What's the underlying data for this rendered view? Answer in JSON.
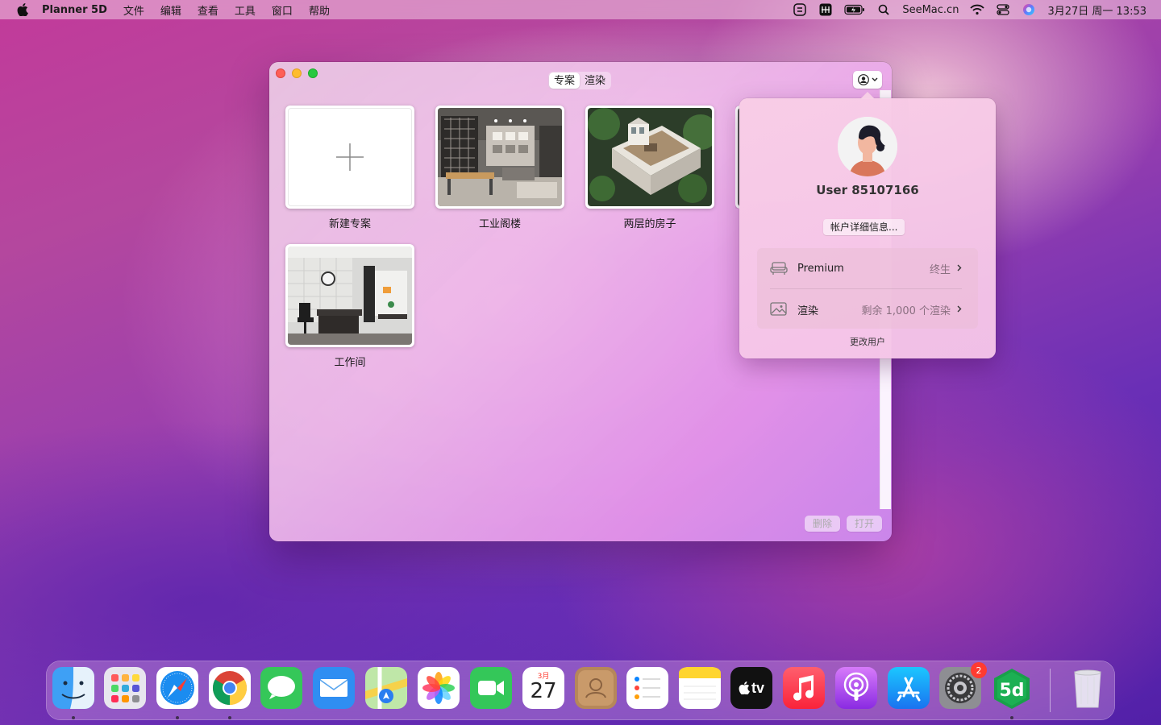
{
  "menubar": {
    "app_name": "Planner 5D",
    "menus": [
      "文件",
      "编辑",
      "查看",
      "工具",
      "窗口",
      "帮助"
    ],
    "site": "SeeMac.cn",
    "datetime": "3月27日 周一  13:53"
  },
  "window": {
    "tabs": [
      "专案",
      "渲染"
    ],
    "active_tab": "专案",
    "projects": [
      {
        "label": "新建专案"
      },
      {
        "label": "工业阁楼"
      },
      {
        "label": "两层的房子"
      },
      {
        "label": "工作间"
      }
    ],
    "buttons": {
      "delete": "删除",
      "open": "打开"
    }
  },
  "popover": {
    "username": "User 85107166",
    "account_details": "帐户详细信息...",
    "rows": [
      {
        "label": "Premium",
        "value": "终生",
        "icon": "sofa-icon"
      },
      {
        "label": "渲染",
        "value": "剩余 1,000 个渲染",
        "icon": "image-icon"
      }
    ],
    "change_user": "更改用户"
  },
  "dock": {
    "apps": [
      "Finder",
      "Launchpad",
      "Safari",
      "Chrome",
      "Messages",
      "Mail",
      "Maps",
      "Photos",
      "FaceTime",
      "Calendar",
      "Contacts",
      "Reminders",
      "Notes",
      "TV",
      "Music",
      "Podcasts",
      "App Store",
      "System Preferences",
      "Planner 5D",
      "Trash"
    ],
    "calendar_month": "3月",
    "calendar_day": "27",
    "tv_label": "tv",
    "sysprefs_badge": "2"
  },
  "colors": {
    "accent": "#0a84ff",
    "badge": "#ff3b30"
  }
}
